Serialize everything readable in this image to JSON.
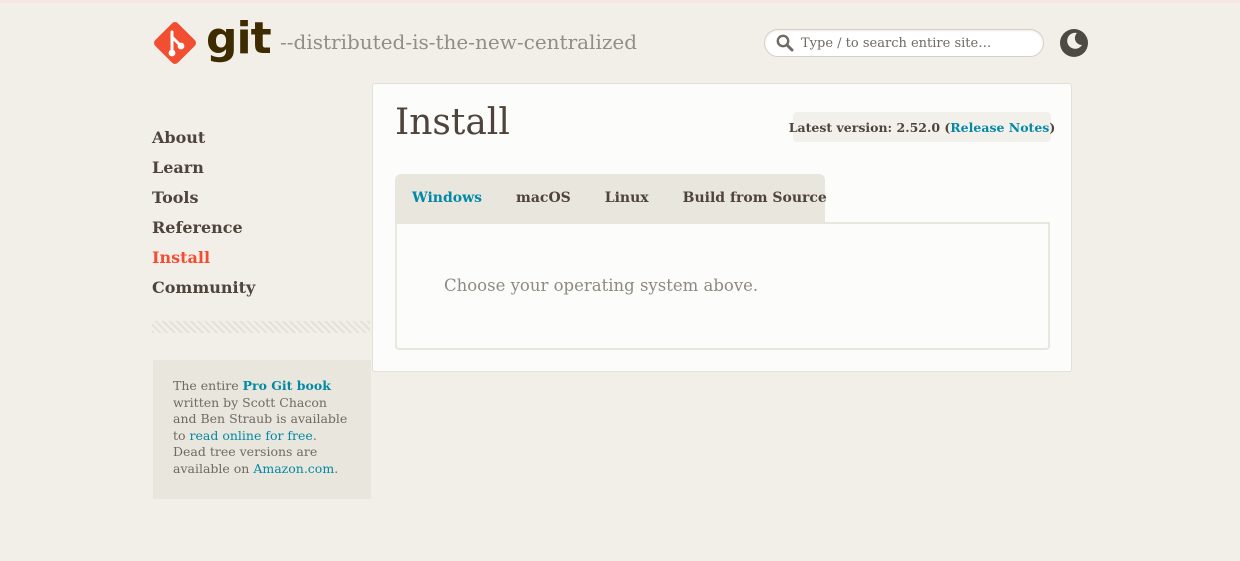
{
  "header": {
    "logo_text": "git",
    "tagline": "--distributed-is-the-new-centralized",
    "search_placeholder": "Type / to search entire site…",
    "icons": {
      "logo": "git-logo-icon",
      "search": "search-icon",
      "theme": "moon-icon"
    }
  },
  "sidebar": {
    "items": [
      {
        "label": "About"
      },
      {
        "label": "Learn"
      },
      {
        "label": "Tools"
      },
      {
        "label": "Reference"
      },
      {
        "label": "Install",
        "active": true
      },
      {
        "label": "Community"
      }
    ],
    "book": {
      "text1": "The entire ",
      "book_link": "Pro Git book",
      "text2": " written by Scott Chacon and Ben Straub is available to ",
      "read_link": "read online for free",
      "text3": ". Dead tree versions are available on ",
      "amazon_link": "Amazon.com",
      "text4": "."
    }
  },
  "main": {
    "title": "Install",
    "version": {
      "prefix": "Latest version: 2.52.0 (",
      "link": "Release Notes",
      "suffix": ")"
    },
    "tabs": [
      {
        "label": "Windows",
        "active": true
      },
      {
        "label": "macOS"
      },
      {
        "label": "Linux"
      },
      {
        "label": "Build from Source"
      }
    ],
    "panel_text": "Choose your operating system above."
  },
  "colors": {
    "background": "#f1efe8",
    "accent_orange": "#f14e32",
    "link_blue": "#0388a6",
    "text_dark": "#4e443c"
  }
}
